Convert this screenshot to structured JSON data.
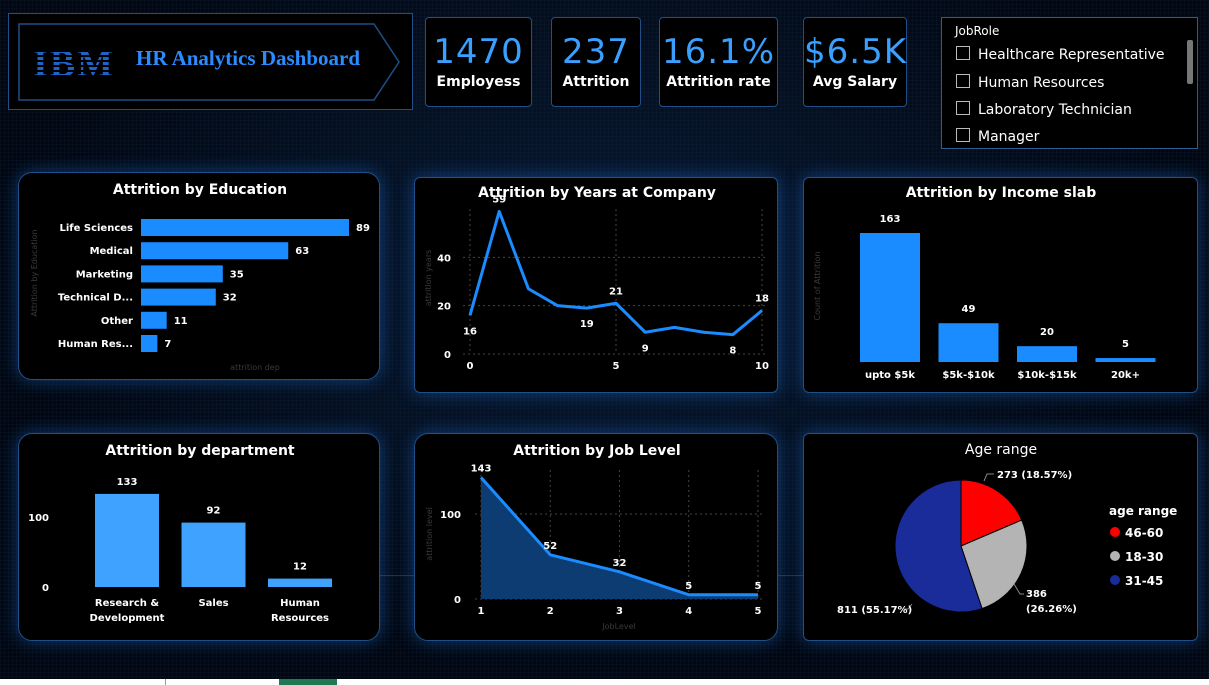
{
  "header": {
    "logo_text": "IBM",
    "title": "HR Analytics Dashboard"
  },
  "kpis": [
    {
      "value": "1470",
      "label": "Employess"
    },
    {
      "value": "237",
      "label": "Attrition"
    },
    {
      "value": "16.1%",
      "label": "Attrition rate"
    },
    {
      "value": "$6.5K",
      "label": "Avg Salary"
    }
  ],
  "slicer": {
    "header": "JobRole",
    "items": [
      "Healthcare Representative",
      "Human Resources",
      "Laboratory Technician",
      "Manager"
    ]
  },
  "colors": {
    "accent": "#1a8cff",
    "dept_bar": "#3fa2ff",
    "area_fill": "#0d3c73",
    "pie_red": "#ff0000",
    "pie_gray": "#b4b4b4",
    "pie_navy": "#1a2b9a"
  },
  "chart_data": [
    {
      "type": "bar",
      "orientation": "horizontal",
      "title": "Attrition by Education",
      "ylabel": "Attrition by Education",
      "xlabel": "attrition dep",
      "categories": [
        "Life Sciences",
        "Medical",
        "Marketing",
        "Technical D...",
        "Other",
        "Human Res..."
      ],
      "values": [
        89,
        63,
        35,
        32,
        11,
        7
      ]
    },
    {
      "type": "line",
      "title": "Attrition by Years at Company",
      "ylabel": "attrition years",
      "x": [
        0,
        1,
        2,
        3,
        4,
        5,
        6,
        7,
        8,
        9,
        10
      ],
      "values": [
        16,
        59,
        27,
        20,
        19,
        21,
        9,
        11,
        9,
        8,
        18
      ],
      "data_labels": {
        "0": "16",
        "1": "59",
        "4": "19",
        "5": "21",
        "6": "9",
        "9": "8",
        "10": "18"
      },
      "xticks": [
        "0",
        "5",
        "10"
      ],
      "yticks": [
        "0",
        "20",
        "40"
      ],
      "ylim": [
        0,
        60
      ],
      "xlim": [
        0,
        10
      ]
    },
    {
      "type": "bar",
      "title": "Attrition by Income slab",
      "ylabel": "Count of Attrition",
      "categories": [
        "upto $5k",
        "$5k-$10k",
        "$10k-$15k",
        "20k+"
      ],
      "values": [
        163,
        49,
        20,
        5
      ]
    },
    {
      "type": "bar",
      "title": "Attrition by department",
      "categories": [
        "Research & Development",
        "Sales",
        "Human Resources"
      ],
      "category_lines": [
        [
          "Research &",
          "Development"
        ],
        [
          "Sales"
        ],
        [
          "Human",
          "Resources"
        ]
      ],
      "values": [
        133,
        92,
        12
      ],
      "yticks": [
        "0",
        "100"
      ]
    },
    {
      "type": "area",
      "title": "Attrition by Job Level",
      "xlabel": "JobLevel",
      "ylabel": "attrition level",
      "x": [
        1,
        2,
        3,
        4,
        5
      ],
      "values": [
        143,
        52,
        32,
        5,
        5
      ],
      "xticks": [
        "1",
        "2",
        "3",
        "4",
        "5"
      ],
      "yticks": [
        "0",
        "100"
      ]
    },
    {
      "type": "pie",
      "title": "Age range",
      "legend_title": "age range",
      "slices": [
        {
          "label": "46-60",
          "value": 273,
          "text": "273 (18.57%)"
        },
        {
          "label": "18-30",
          "value": 386,
          "text": "386 (26.26%)"
        },
        {
          "label": "31-45",
          "value": 811,
          "text": "811 (55.17%)"
        }
      ]
    }
  ]
}
